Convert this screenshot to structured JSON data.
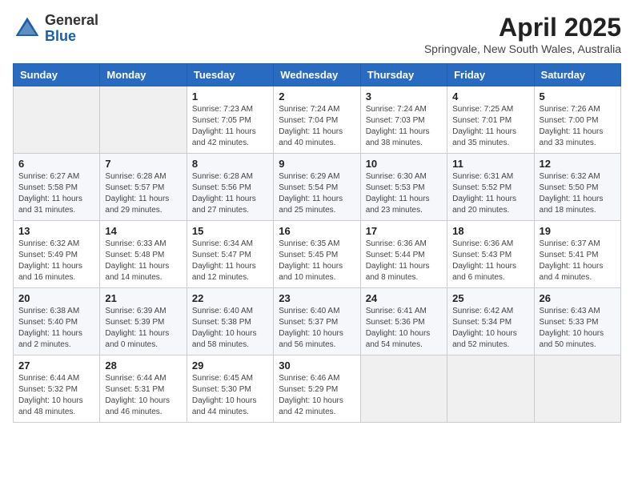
{
  "header": {
    "logo_general": "General",
    "logo_blue": "Blue",
    "month_title": "April 2025",
    "location": "Springvale, New South Wales, Australia"
  },
  "days_of_week": [
    "Sunday",
    "Monday",
    "Tuesday",
    "Wednesday",
    "Thursday",
    "Friday",
    "Saturday"
  ],
  "weeks": [
    [
      {
        "day": "",
        "detail": ""
      },
      {
        "day": "",
        "detail": ""
      },
      {
        "day": "1",
        "detail": "Sunrise: 7:23 AM\nSunset: 7:05 PM\nDaylight: 11 hours and 42 minutes."
      },
      {
        "day": "2",
        "detail": "Sunrise: 7:24 AM\nSunset: 7:04 PM\nDaylight: 11 hours and 40 minutes."
      },
      {
        "day": "3",
        "detail": "Sunrise: 7:24 AM\nSunset: 7:03 PM\nDaylight: 11 hours and 38 minutes."
      },
      {
        "day": "4",
        "detail": "Sunrise: 7:25 AM\nSunset: 7:01 PM\nDaylight: 11 hours and 35 minutes."
      },
      {
        "day": "5",
        "detail": "Sunrise: 7:26 AM\nSunset: 7:00 PM\nDaylight: 11 hours and 33 minutes."
      }
    ],
    [
      {
        "day": "6",
        "detail": "Sunrise: 6:27 AM\nSunset: 5:58 PM\nDaylight: 11 hours and 31 minutes."
      },
      {
        "day": "7",
        "detail": "Sunrise: 6:28 AM\nSunset: 5:57 PM\nDaylight: 11 hours and 29 minutes."
      },
      {
        "day": "8",
        "detail": "Sunrise: 6:28 AM\nSunset: 5:56 PM\nDaylight: 11 hours and 27 minutes."
      },
      {
        "day": "9",
        "detail": "Sunrise: 6:29 AM\nSunset: 5:54 PM\nDaylight: 11 hours and 25 minutes."
      },
      {
        "day": "10",
        "detail": "Sunrise: 6:30 AM\nSunset: 5:53 PM\nDaylight: 11 hours and 23 minutes."
      },
      {
        "day": "11",
        "detail": "Sunrise: 6:31 AM\nSunset: 5:52 PM\nDaylight: 11 hours and 20 minutes."
      },
      {
        "day": "12",
        "detail": "Sunrise: 6:32 AM\nSunset: 5:50 PM\nDaylight: 11 hours and 18 minutes."
      }
    ],
    [
      {
        "day": "13",
        "detail": "Sunrise: 6:32 AM\nSunset: 5:49 PM\nDaylight: 11 hours and 16 minutes."
      },
      {
        "day": "14",
        "detail": "Sunrise: 6:33 AM\nSunset: 5:48 PM\nDaylight: 11 hours and 14 minutes."
      },
      {
        "day": "15",
        "detail": "Sunrise: 6:34 AM\nSunset: 5:47 PM\nDaylight: 11 hours and 12 minutes."
      },
      {
        "day": "16",
        "detail": "Sunrise: 6:35 AM\nSunset: 5:45 PM\nDaylight: 11 hours and 10 minutes."
      },
      {
        "day": "17",
        "detail": "Sunrise: 6:36 AM\nSunset: 5:44 PM\nDaylight: 11 hours and 8 minutes."
      },
      {
        "day": "18",
        "detail": "Sunrise: 6:36 AM\nSunset: 5:43 PM\nDaylight: 11 hours and 6 minutes."
      },
      {
        "day": "19",
        "detail": "Sunrise: 6:37 AM\nSunset: 5:41 PM\nDaylight: 11 hours and 4 minutes."
      }
    ],
    [
      {
        "day": "20",
        "detail": "Sunrise: 6:38 AM\nSunset: 5:40 PM\nDaylight: 11 hours and 2 minutes."
      },
      {
        "day": "21",
        "detail": "Sunrise: 6:39 AM\nSunset: 5:39 PM\nDaylight: 11 hours and 0 minutes."
      },
      {
        "day": "22",
        "detail": "Sunrise: 6:40 AM\nSunset: 5:38 PM\nDaylight: 10 hours and 58 minutes."
      },
      {
        "day": "23",
        "detail": "Sunrise: 6:40 AM\nSunset: 5:37 PM\nDaylight: 10 hours and 56 minutes."
      },
      {
        "day": "24",
        "detail": "Sunrise: 6:41 AM\nSunset: 5:36 PM\nDaylight: 10 hours and 54 minutes."
      },
      {
        "day": "25",
        "detail": "Sunrise: 6:42 AM\nSunset: 5:34 PM\nDaylight: 10 hours and 52 minutes."
      },
      {
        "day": "26",
        "detail": "Sunrise: 6:43 AM\nSunset: 5:33 PM\nDaylight: 10 hours and 50 minutes."
      }
    ],
    [
      {
        "day": "27",
        "detail": "Sunrise: 6:44 AM\nSunset: 5:32 PM\nDaylight: 10 hours and 48 minutes."
      },
      {
        "day": "28",
        "detail": "Sunrise: 6:44 AM\nSunset: 5:31 PM\nDaylight: 10 hours and 46 minutes."
      },
      {
        "day": "29",
        "detail": "Sunrise: 6:45 AM\nSunset: 5:30 PM\nDaylight: 10 hours and 44 minutes."
      },
      {
        "day": "30",
        "detail": "Sunrise: 6:46 AM\nSunset: 5:29 PM\nDaylight: 10 hours and 42 minutes."
      },
      {
        "day": "",
        "detail": ""
      },
      {
        "day": "",
        "detail": ""
      },
      {
        "day": "",
        "detail": ""
      }
    ]
  ]
}
